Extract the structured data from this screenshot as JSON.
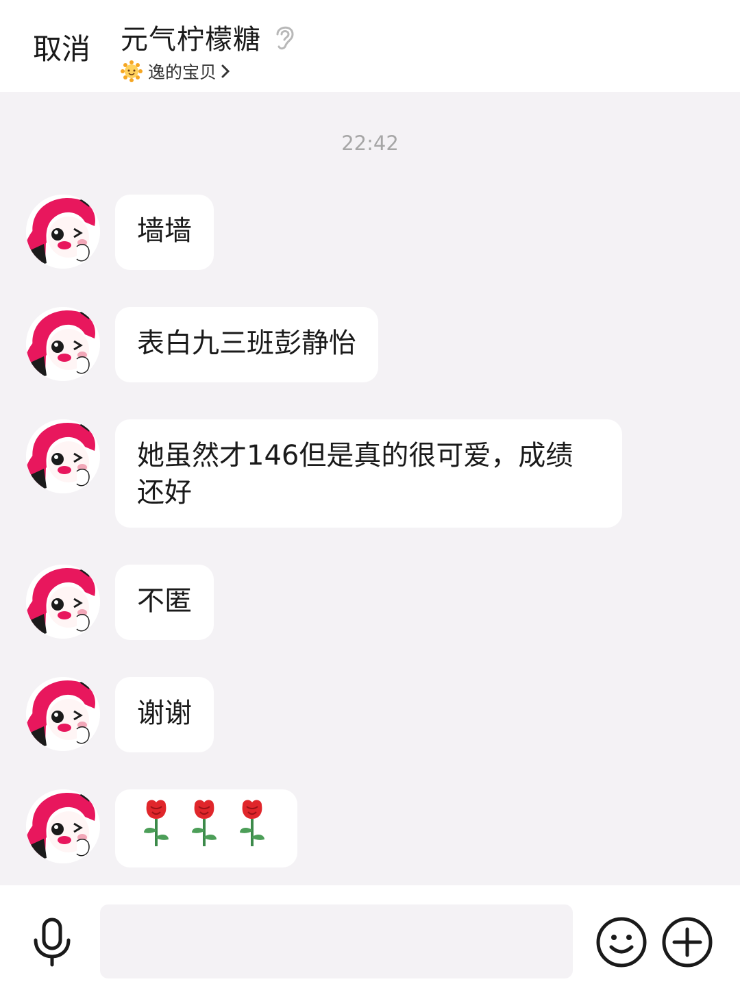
{
  "header": {
    "cancel_label": "取消",
    "title": "元气柠檬糖",
    "subtitle": "逸的宝贝",
    "icons": {
      "ear": "ear-icon",
      "badge": "sun-icon",
      "chevron": "chevron-right-icon"
    }
  },
  "chat": {
    "timestamp": "22:42",
    "messages": [
      {
        "text": "墙墙"
      },
      {
        "text": "表白九三班彭静怡"
      },
      {
        "text": "她虽然才146但是真的很可爱，成绩还好"
      },
      {
        "text": "不匿"
      },
      {
        "text": "谢谢"
      },
      {
        "emoji": "rose-icon",
        "count": 3
      }
    ]
  },
  "input_bar": {
    "placeholder": "",
    "icons": [
      "microphone-icon",
      "emoji-icon",
      "plus-icon"
    ]
  },
  "colors": {
    "background": "#f4f2f5",
    "bubble": "#ffffff",
    "timestamp": "#a6a6a6",
    "avatar_accent": "#e8175d"
  }
}
